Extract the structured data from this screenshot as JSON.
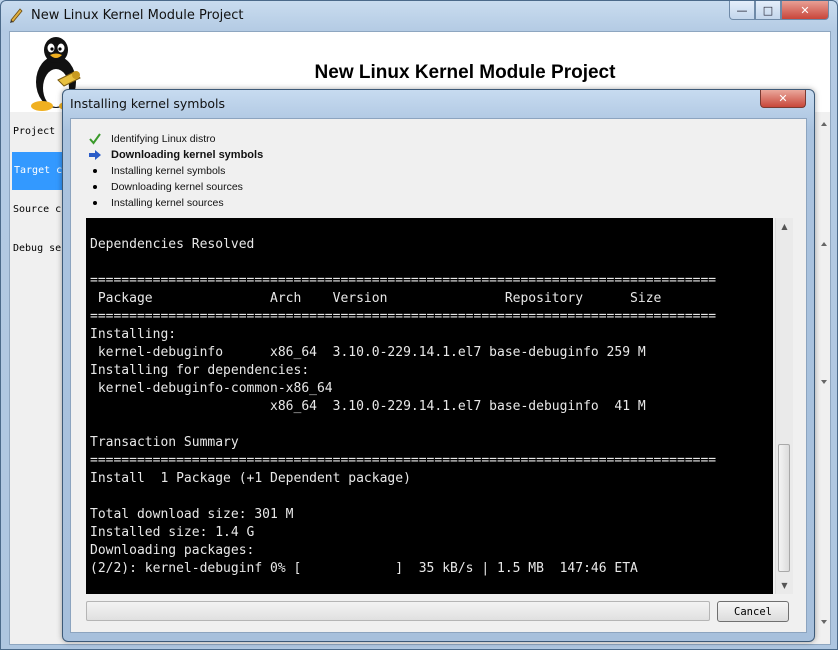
{
  "window": {
    "title": "New Linux Kernel Module Project",
    "icon": "pencil-icon",
    "controls": {
      "minimize": "—",
      "maximize": "□",
      "close": "✕"
    }
  },
  "header": {
    "title": "New Linux Kernel Module Project",
    "logo": "tux-penguin-icon"
  },
  "sidebar": {
    "items": [
      {
        "label": "Project"
      },
      {
        "label": "Target c"
      },
      {
        "label": "Source c"
      },
      {
        "label": "Debug se"
      }
    ],
    "selected_index": 1
  },
  "dialog": {
    "title": "Installing kernel symbols",
    "close": "✕",
    "steps": [
      {
        "label": "Identifying Linux distro",
        "state": "done",
        "icon": "check-icon"
      },
      {
        "label": "Downloading kernel symbols",
        "state": "current",
        "icon": "arrow-right-icon"
      },
      {
        "label": "Installing kernel symbols",
        "state": "pending",
        "icon": "bullet-icon"
      },
      {
        "label": "Downloading kernel sources",
        "state": "pending",
        "icon": "bullet-icon"
      },
      {
        "label": "Installing kernel sources",
        "state": "pending",
        "icon": "bullet-icon"
      }
    ],
    "terminal_lines": [
      "",
      "Dependencies Resolved",
      "",
      "================================================================================",
      " Package               Arch    Version               Repository      Size",
      "================================================================================",
      "Installing:",
      " kernel-debuginfo      x86_64  3.10.0-229.14.1.el7 base-debuginfo 259 M",
      "Installing for dependencies:",
      " kernel-debuginfo-common-x86_64",
      "                       x86_64  3.10.0-229.14.1.el7 base-debuginfo  41 M",
      "",
      "Transaction Summary",
      "================================================================================",
      "Install  1 Package (+1 Dependent package)",
      "",
      "Total download size: 301 M",
      "Installed size: 1.4 G",
      "Downloading packages:",
      "(2/2): kernel-debuginf 0% [            ]  35 kB/s | 1.5 MB  147:46 ETA"
    ],
    "progress_fraction": 0,
    "cancel_label": "Cancel"
  },
  "colors": {
    "terminal_bg": "#000000",
    "terminal_fg": "#e8e8e8",
    "selection": "#3399ff",
    "close_button": "#c8473a"
  }
}
